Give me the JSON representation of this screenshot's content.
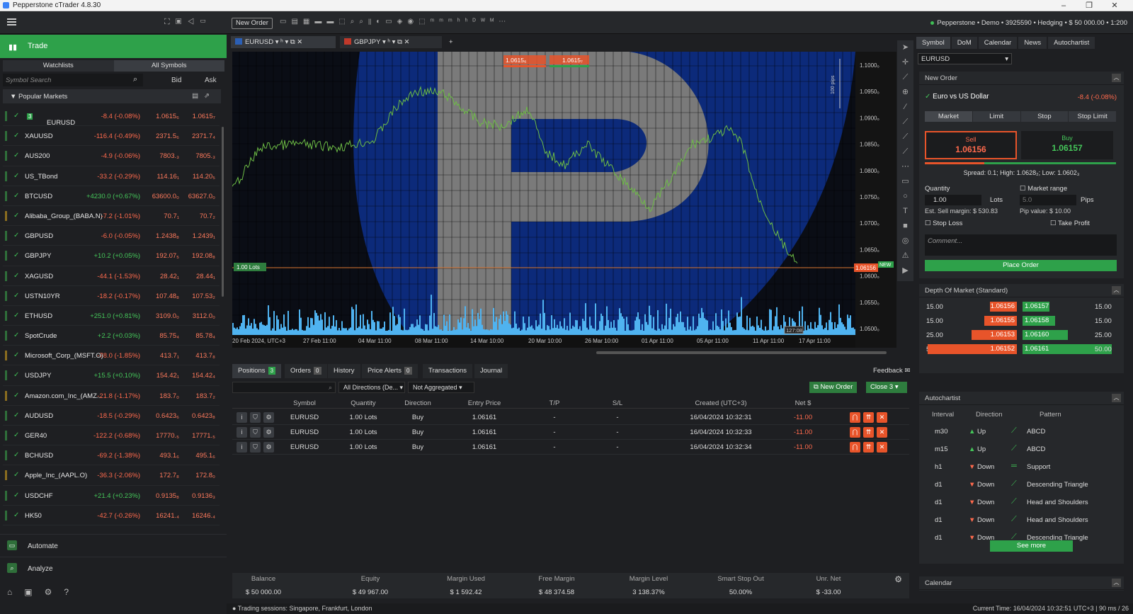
{
  "window": {
    "title": "Pepperstone cTrader 4.8.30",
    "min": "–",
    "max": "❐",
    "close": "✕"
  },
  "topbar": {
    "new_order": "New Order",
    "account": "Pepperstone • Demo • 3925590 • Hedging • $ 50 000.00 • 1:200"
  },
  "left": {
    "trade": "Trade",
    "tabs": [
      "Watchlists",
      "All Symbols"
    ],
    "search_placeholder": "Symbol Search",
    "bid": "Bid",
    "ask": "Ask",
    "section": "Popular Markets",
    "symbols": [
      {
        "name": "EURUSD",
        "badge": "3",
        "change": "-8.4 (-0.08%)",
        "bid": "1.0615₆",
        "ask": "1.0615₇",
        "up": false
      },
      {
        "name": "XAUUSD",
        "change": "-116.4 (-0.49%)",
        "bid": "2371.5₆",
        "ask": "2371.7₄",
        "up": false
      },
      {
        "name": "AUS200",
        "change": "-4.9 (-0.06%)",
        "bid": "7803.₃",
        "ask": "7805.₃",
        "up": false
      },
      {
        "name": "US_TBond",
        "change": "-33.2 (-0.29%)",
        "bid": "114.16₁",
        "ask": "114.20₅",
        "up": false
      },
      {
        "name": "BTCUSD",
        "change": "+4230.0 (+0.67%)",
        "bid": "63600.0₀",
        "ask": "63627.0₀",
        "up": true
      },
      {
        "name": "Alibaba_Group_(BABA.N)",
        "change": "-7.2 (-1.01%)",
        "bid": "70.7₁",
        "ask": "70.7₂",
        "up": false
      },
      {
        "name": "GBPUSD",
        "change": "-6.0 (-0.05%)",
        "bid": "1.2438₈",
        "ask": "1.2439₁",
        "up": false
      },
      {
        "name": "GBPJPY",
        "change": "+10.2 (+0.05%)",
        "bid": "192.07₅",
        "ask": "192.08₈",
        "up": true
      },
      {
        "name": "XAGUSD",
        "change": "-44.1 (-1.53%)",
        "bid": "28.42₁",
        "ask": "28.44₁",
        "up": false
      },
      {
        "name": "USTN10YR",
        "change": "-18.2 (-0.17%)",
        "bid": "107.48₈",
        "ask": "107.53₂",
        "up": false
      },
      {
        "name": "ETHUSD",
        "change": "+251.0 (+0.81%)",
        "bid": "3109.0₀",
        "ask": "3112.0₀",
        "up": true
      },
      {
        "name": "SpotCrude",
        "change": "+2.2 (+0.03%)",
        "bid": "85.75₄",
        "ask": "85.78₄",
        "up": true
      },
      {
        "name": "Microsoft_Corp_(MSFT.O)",
        "change": "-78.0 (-1.85%)",
        "bid": "413.7₁",
        "ask": "413.7₈",
        "up": false
      },
      {
        "name": "USDJPY",
        "change": "+15.5 (+0.10%)",
        "bid": "154.42₁",
        "ask": "154.42₄",
        "up": true
      },
      {
        "name": "Amazon.com_Inc_(AMZ...",
        "change": "-21.8 (-1.17%)",
        "bid": "183.7₀",
        "ask": "183.7₂",
        "up": false
      },
      {
        "name": "AUDUSD",
        "change": "-18.5 (-0.29%)",
        "bid": "0.6423₆",
        "ask": "0.6423₈",
        "up": false
      },
      {
        "name": "GER40",
        "change": "-122.2 (-0.68%)",
        "bid": "17770.₅",
        "ask": "17771.₅",
        "up": false
      },
      {
        "name": "BCHUSD",
        "change": "-69.2 (-1.38%)",
        "bid": "493.1₆",
        "ask": "495.1₆",
        "up": false
      },
      {
        "name": "Apple_Inc_(AAPL.O)",
        "change": "-36.3 (-2.06%)",
        "bid": "172.7₈",
        "ask": "172.8₀",
        "up": false
      },
      {
        "name": "USDCHF",
        "change": "+21.4 (+0.23%)",
        "bid": "0.9135₈",
        "ask": "0.9136₃",
        "up": true
      },
      {
        "name": "HK50",
        "change": "-42.7 (-0.26%)",
        "bid": "16241.₄",
        "ask": "16246.₄",
        "up": false
      }
    ],
    "nav": [
      "Automate",
      "Analyze"
    ]
  },
  "chart": {
    "tabs": [
      "EURUSD",
      "GBPJPY"
    ],
    "sell_price": "1.0615₆",
    "buy_price": "1.0615₇",
    "price_axis": [
      "1.1000₀",
      "1.0950₀",
      "1.0900₀",
      "1.0850₀",
      "1.0800₀",
      "1.0750₀",
      "1.0700₀",
      "1.0650₀",
      "1.0600₀",
      "1.0550₀",
      "1.0500₀"
    ],
    "time_axis": [
      "20 Feb 2024, UTC+3",
      "27 Feb 11:00",
      "04 Mar 11:00",
      "08 Mar 11:00",
      "14 Mar 10:00",
      "20 Mar 10:00",
      "26 Mar 10:00",
      "01 Apr 11:00",
      "05 Apr 11:00",
      "11 Apr 11:00",
      "17 Apr 11:00"
    ],
    "pips_label": "100 pips",
    "lots_label": "1.00 Lots",
    "current_price": "1.06156",
    "new_label": "NEW",
    "timer": "127:08"
  },
  "positions": {
    "tabs": [
      {
        "label": "Positions",
        "count": "3"
      },
      {
        "label": "Orders",
        "count": "0"
      },
      {
        "label": "History"
      },
      {
        "label": "Price Alerts",
        "count": "0"
      },
      {
        "label": "Transactions"
      },
      {
        "label": "Journal"
      }
    ],
    "feedback": "Feedback",
    "filter_dir": "All Directions (De...",
    "filter_agg": "Not Aggregated",
    "new_order": "New Order",
    "close": "Close  3",
    "headers": [
      "Symbol",
      "Quantity",
      "Direction",
      "Entry Price",
      "T/P",
      "S/L",
      "Created (UTC+3)",
      "Net $"
    ],
    "rows": [
      [
        "EURUSD",
        "1.00 Lots",
        "Buy",
        "1.06161",
        "-",
        "-",
        "16/04/2024 10:32:31",
        "-11.00"
      ],
      [
        "EURUSD",
        "1.00 Lots",
        "Buy",
        "1.06161",
        "-",
        "-",
        "16/04/2024 10:32:33",
        "-11.00"
      ],
      [
        "EURUSD",
        "1.00 Lots",
        "Buy",
        "1.06161",
        "-",
        "-",
        "16/04/2024 10:32:34",
        "-11.00"
      ]
    ],
    "summary": [
      {
        "h": "Balance",
        "v": "$ 50 000.00"
      },
      {
        "h": "Equity",
        "v": "$ 49 967.00"
      },
      {
        "h": "Margin Used",
        "v": "$ 1 592.42"
      },
      {
        "h": "Free Margin",
        "v": "$ 48 374.58"
      },
      {
        "h": "Margin Level",
        "v": "3 138.37%"
      },
      {
        "h": "Smart Stop Out",
        "v": "50.00%"
      },
      {
        "h": "Unr. Net",
        "v": "$ -33.00"
      }
    ]
  },
  "status": {
    "sessions": "Trading sessions: Singapore, Frankfurt, London",
    "time": "Current Time: 16/04/2024 10:32:51   UTC+3   |   90 ms / 26"
  },
  "right": {
    "tabs": [
      "Symbol",
      "DoM",
      "Calendar",
      "News",
      "Autochartist"
    ],
    "symbol": "EURUSD",
    "new_order": "New Order",
    "pair": "Euro vs US Dollar",
    "pair_change": "-8.4 (-0.08%)",
    "order_types": [
      "Market",
      "Limit",
      "Stop",
      "Stop Limit"
    ],
    "sell_label": "Sell",
    "sell": "1.06156",
    "buy_label": "Buy",
    "buy": "1.06157",
    "spread": "Spread: 0.1; High: 1.0628₂; Low: 1.0602₃",
    "quantity_label": "Quantity",
    "quantity": "1.00",
    "lots": "Lots",
    "market_range": "Market range",
    "range_val": "5.0",
    "pips": "Pips",
    "est_margin": "Est. Sell margin: $ 530.83",
    "pip_value": "Pip value: $ 10.00",
    "stop_loss": "Stop Loss",
    "take_profit": "Take Profit",
    "comment_ph": "Comment...",
    "place_order": "Place Order",
    "dom_title": "Depth Of Market (Standard)",
    "dom": [
      {
        "sq": "15.00",
        "sp": "1.06156",
        "bp": "1.06157",
        "bq": "15.00"
      },
      {
        "sq": "15.00",
        "sp": "1.06155",
        "bp": "1.06158",
        "bq": "15.00"
      },
      {
        "sq": "25.00",
        "sp": "1.06153",
        "bp": "1.06160",
        "bq": "25.00"
      },
      {
        "sq": "50.00",
        "sp": "1.06152",
        "bp": "1.06161",
        "bq": "50.00"
      }
    ],
    "auto_title": "Autochartist",
    "auto_headers": [
      "Interval",
      "Direction",
      "Pattern"
    ],
    "auto": [
      {
        "i": "m30",
        "d": "Up",
        "p": "ABCD"
      },
      {
        "i": "m15",
        "d": "Up",
        "p": "ABCD"
      },
      {
        "i": "h1",
        "d": "Down",
        "p": "Support"
      },
      {
        "i": "d1",
        "d": "Down",
        "p": "Descending Triangle"
      },
      {
        "i": "d1",
        "d": "Down",
        "p": "Head and Shoulders"
      },
      {
        "i": "d1",
        "d": "Down",
        "p": "Head and Shoulders"
      },
      {
        "i": "d1",
        "d": "Down",
        "p": "Descending Triangle"
      }
    ],
    "see_more": "See more",
    "calendar": "Calendar"
  }
}
